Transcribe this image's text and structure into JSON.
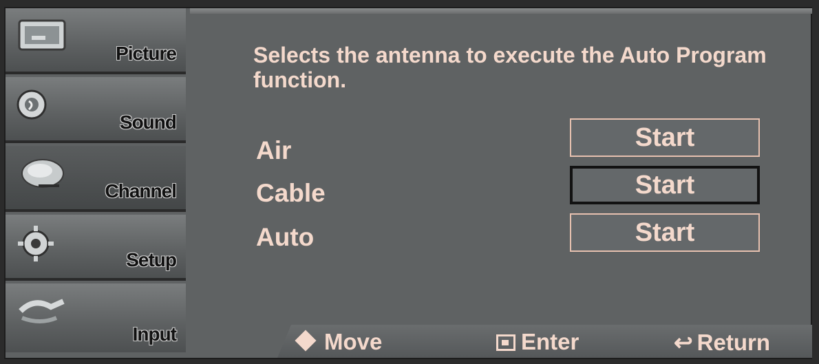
{
  "sidebar": {
    "items": [
      {
        "label": "Picture",
        "icon": "picture-icon"
      },
      {
        "label": "Sound",
        "icon": "sound-icon"
      },
      {
        "label": "Channel",
        "icon": "channel-icon"
      },
      {
        "label": "Setup",
        "icon": "setup-icon"
      },
      {
        "label": "Input",
        "icon": "input-icon"
      }
    ],
    "active_index": 2
  },
  "main": {
    "description": "Selects the antenna to execute the Auto Program function.",
    "rows": [
      {
        "label": "Air",
        "button": "Start"
      },
      {
        "label": "Cable",
        "button": "Start"
      },
      {
        "label": "Auto",
        "button": "Start"
      }
    ],
    "selected_row": 1
  },
  "helpbar": {
    "move": "Move",
    "enter": "Enter",
    "return": "Return"
  },
  "colors": {
    "text": "#f4d9cc",
    "panel": "#5f6263",
    "button_border": "#e7c1b0",
    "selected_border": "#121212"
  }
}
